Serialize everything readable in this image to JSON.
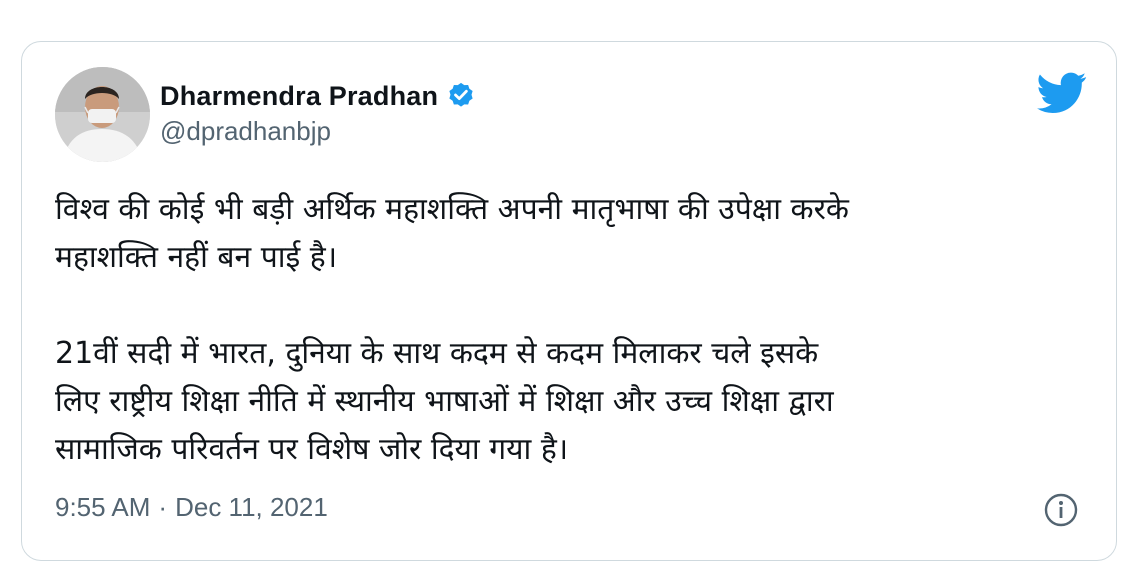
{
  "author": {
    "display_name": "Dharmendra Pradhan",
    "handle": "@dpradhanbjp",
    "verified": true
  },
  "tweet": {
    "paragraphs": [
      [
        "विश्व की कोई भी बड़ी अर्थिक महाशक्ति अपनी मातृभाषा की उपेक्षा करके",
        "महाशक्ति नहीं बन पाई है।"
      ],
      [
        "21वीं सदी में भारत, दुनिया के साथ कदम से कदम मिलाकर चले इसके",
        "लिए राष्ट्रीय शिक्षा नीति में स्थानीय भाषाओं में शिक्षा और उच्च शिक्षा द्वारा",
        "सामाजिक परिवर्तन पर विशेष जोर दिया गया है।"
      ]
    ],
    "time": "9:55 AM",
    "separator": "·",
    "date": "Dec 11, 2021"
  },
  "icons": {
    "logo": "twitter-bird-icon",
    "verified": "verified-badge-icon",
    "info": "info-icon"
  },
  "colors": {
    "twitter_blue": "#1d9bf0",
    "text_primary": "#0f1419",
    "text_secondary": "#536471",
    "border": "#cfd9de"
  }
}
